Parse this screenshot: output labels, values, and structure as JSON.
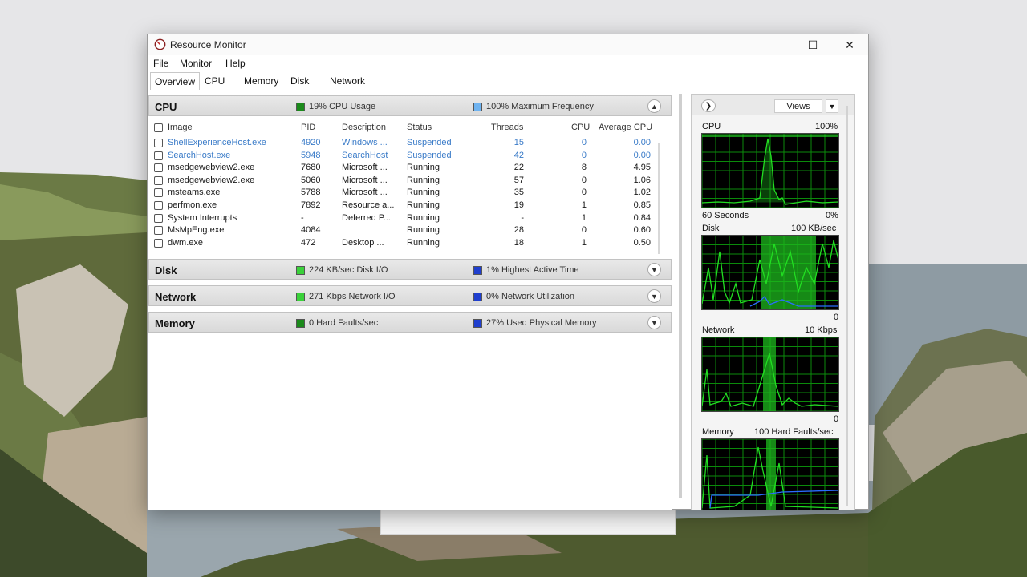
{
  "window": {
    "title": "Resource Monitor",
    "minimize_glyph": "—",
    "maximize_glyph": "☐",
    "close_glyph": "✕"
  },
  "menu": [
    "File",
    "Monitor",
    "Help"
  ],
  "tabs": [
    "Overview",
    "CPU",
    "Memory",
    "Disk",
    "Network"
  ],
  "active_tab": "Overview",
  "colors": {
    "graph_line": "#22dd22",
    "graph_grid": "#0b8a0b",
    "graph_fill": "#1eb81e",
    "memory_line": "#2a6cff",
    "suspended_text": "#3a7bc8"
  },
  "cpu_section": {
    "title": "CPU",
    "stat1": "19% CPU Usage",
    "stat2": "100% Maximum Frequency",
    "columns": [
      "Image",
      "PID",
      "Description",
      "Status",
      "Threads",
      "CPU",
      "Average CPU"
    ],
    "rows": [
      {
        "image": "ShellExperienceHost.exe",
        "pid": "4920",
        "description": "Windows ...",
        "status": "Suspended",
        "threads": "15",
        "cpu": "0",
        "avg": "0.00"
      },
      {
        "image": "SearchHost.exe",
        "pid": "5948",
        "description": "SearchHost",
        "status": "Suspended",
        "threads": "42",
        "cpu": "0",
        "avg": "0.00"
      },
      {
        "image": "msedgewebview2.exe",
        "pid": "7680",
        "description": "Microsoft ...",
        "status": "Running",
        "threads": "22",
        "cpu": "8",
        "avg": "4.95"
      },
      {
        "image": "msedgewebview2.exe",
        "pid": "5060",
        "description": "Microsoft ...",
        "status": "Running",
        "threads": "57",
        "cpu": "0",
        "avg": "1.06"
      },
      {
        "image": "msteams.exe",
        "pid": "5788",
        "description": "Microsoft ...",
        "status": "Running",
        "threads": "35",
        "cpu": "0",
        "avg": "1.02"
      },
      {
        "image": "perfmon.exe",
        "pid": "7892",
        "description": "Resource a...",
        "status": "Running",
        "threads": "19",
        "cpu": "1",
        "avg": "0.85"
      },
      {
        "image": "System Interrupts",
        "pid": "-",
        "description": "Deferred P...",
        "status": "Running",
        "threads": "-",
        "cpu": "1",
        "avg": "0.84"
      },
      {
        "image": "MsMpEng.exe",
        "pid": "4084",
        "description": "",
        "status": "Running",
        "threads": "28",
        "cpu": "0",
        "avg": "0.60"
      },
      {
        "image": "dwm.exe",
        "pid": "472",
        "description": "Desktop ...",
        "status": "Running",
        "threads": "18",
        "cpu": "1",
        "avg": "0.50"
      }
    ]
  },
  "disk_section": {
    "title": "Disk",
    "stat1": "224 KB/sec Disk I/O",
    "stat2": "1% Highest Active Time"
  },
  "network_section": {
    "title": "Network",
    "stat1": "271 Kbps Network I/O",
    "stat2": "0% Network Utilization"
  },
  "memory_section": {
    "title": "Memory",
    "stat1": "0 Hard Faults/sec",
    "stat2": "27% Used Physical Memory"
  },
  "side": {
    "views_label": "Views",
    "cpu_graph": {
      "title": "CPU",
      "max": "100%",
      "footer_left": "60 Seconds",
      "footer_right": "0%"
    },
    "disk_graph": {
      "title": "Disk",
      "max": "100 KB/sec",
      "footer_right": "0"
    },
    "network_graph": {
      "title": "Network",
      "max": "10 Kbps",
      "footer_right": "0"
    },
    "memory_graph": {
      "title": "Memory",
      "max": "100 Hard Faults/sec"
    }
  }
}
